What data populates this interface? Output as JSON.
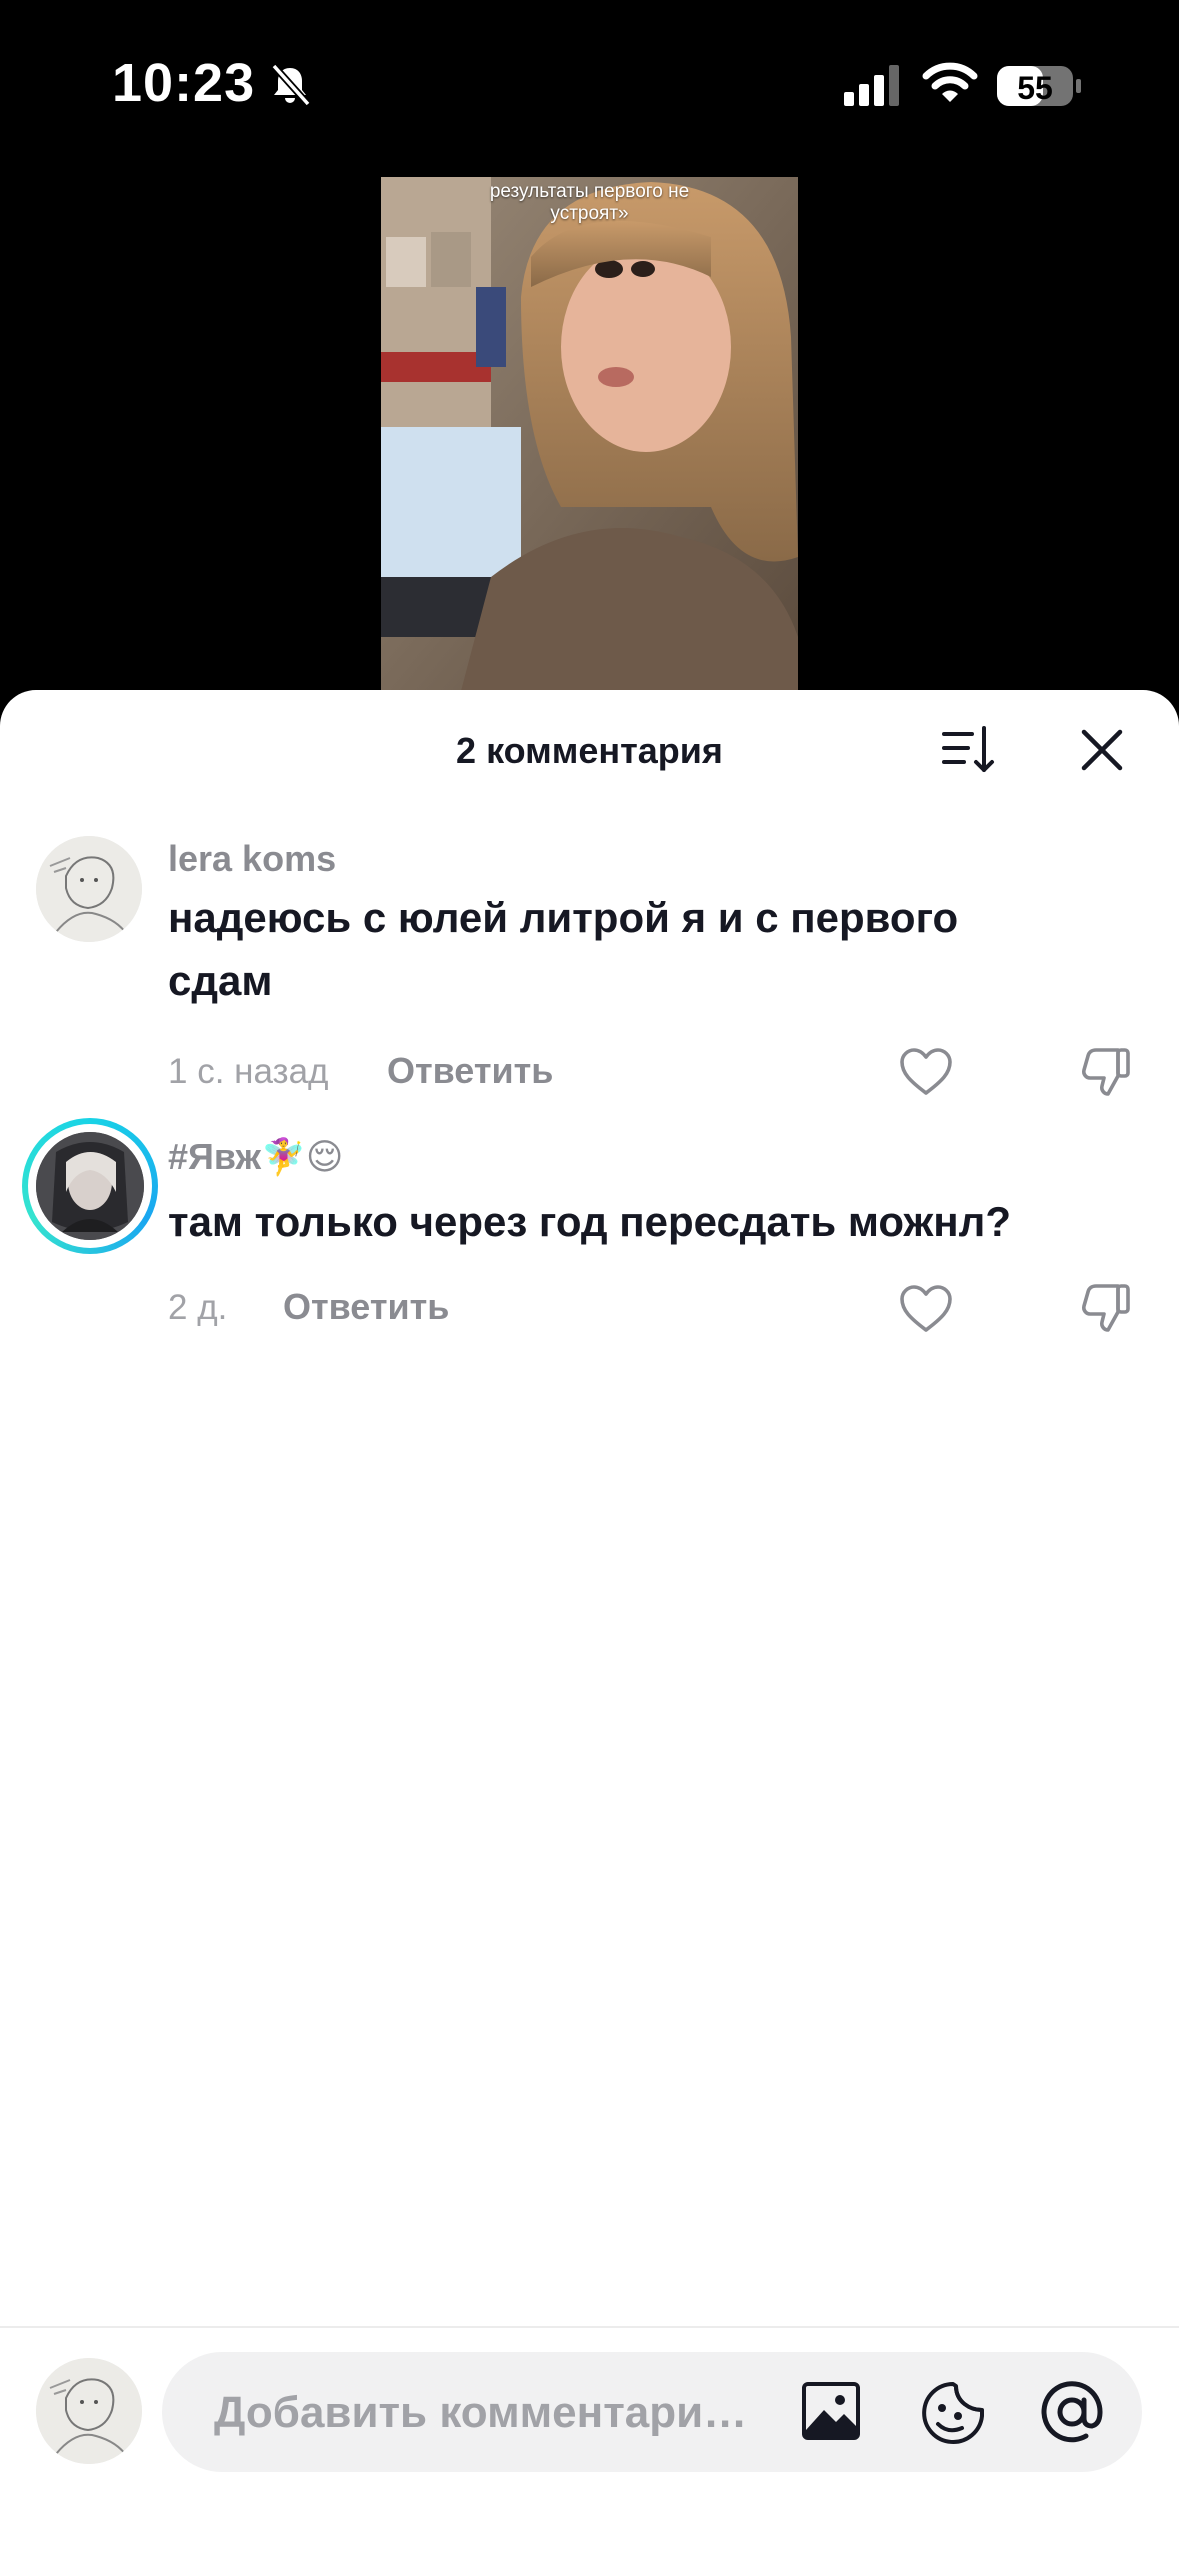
{
  "status_bar": {
    "time": "10:23",
    "battery": "55"
  },
  "video": {
    "caption_lines": [
      "результаты первого не",
      "устроят»"
    ]
  },
  "comments_sheet": {
    "title": "2 комментария",
    "comments": [
      {
        "username": "lera koms",
        "text": "надеюсь с юлей литрой я и с первого сдам",
        "time": "1 с. назад",
        "reply_label": "Ответить"
      },
      {
        "username": "#Явж🧚‍♀️😌",
        "text": "там только через год пересдать можнл?",
        "time": "2 д.",
        "reply_label": "Ответить"
      }
    ]
  },
  "composer": {
    "placeholder": "Добавить комментари…"
  },
  "icons": [
    "bell-slash-icon",
    "signal-icon",
    "wifi-icon",
    "battery-icon",
    "sort-icon",
    "close-icon",
    "heart-icon",
    "thumbs-down-icon",
    "image-icon",
    "sticker-icon",
    "at-icon"
  ]
}
